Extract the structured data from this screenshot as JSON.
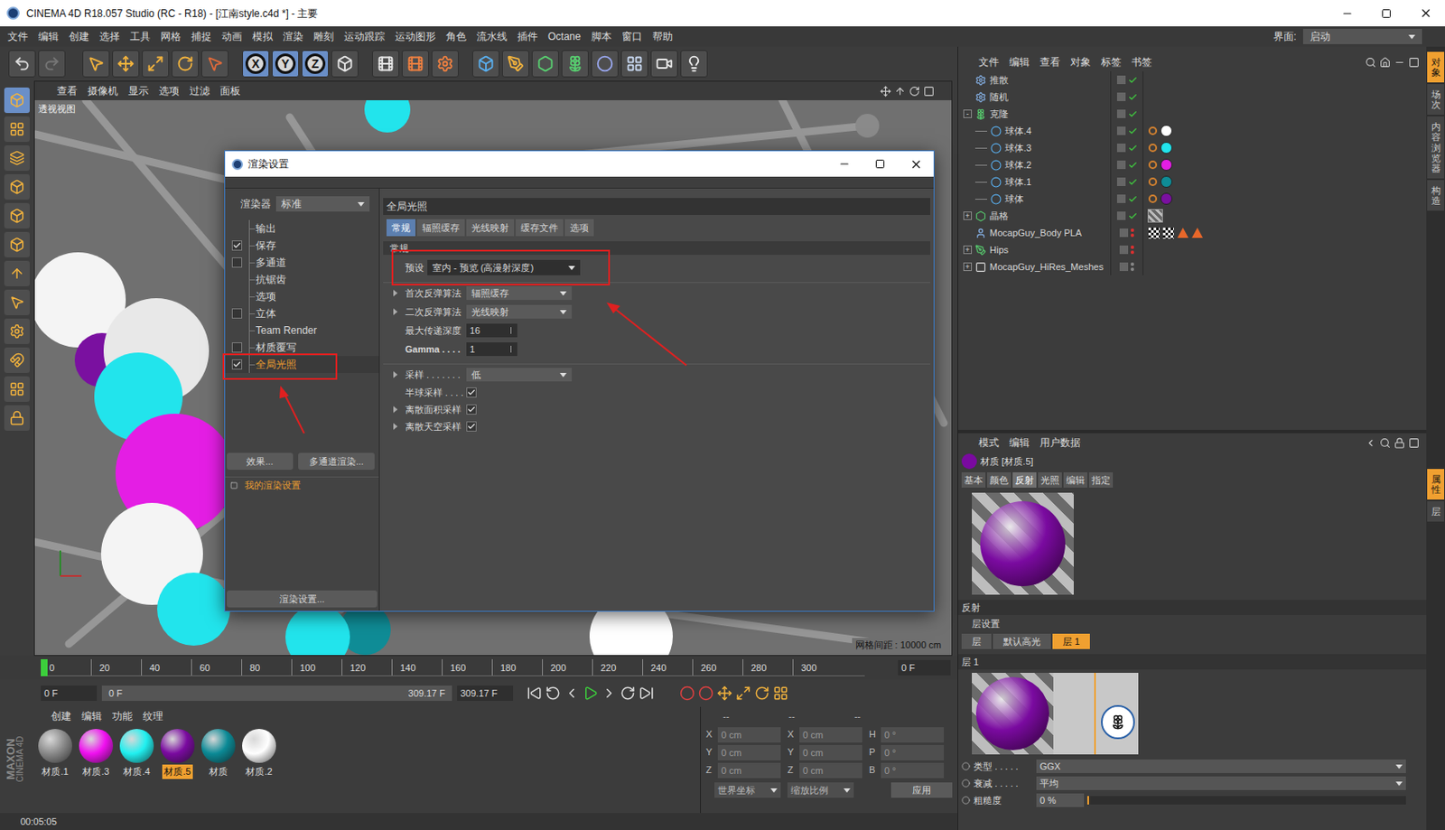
{
  "window": {
    "title": "CINEMA 4D R18.057 Studio (RC - R18) - [江南style.c4d *] - 主要"
  },
  "menu": [
    "文件",
    "编辑",
    "创建",
    "选择",
    "工具",
    "网格",
    "捕捉",
    "动画",
    "模拟",
    "渲染",
    "雕刻",
    "运动跟踪",
    "运动图形",
    "角色",
    "流水线",
    "插件",
    "Octane",
    "脚本",
    "窗口",
    "帮助"
  ],
  "layout": {
    "label": "界面:",
    "value": "启动"
  },
  "toolbar": {
    "axes": [
      {
        "label": "X",
        "on": true
      },
      {
        "label": "Y",
        "on": true
      },
      {
        "label": "Z",
        "on": true
      }
    ]
  },
  "viewport": {
    "menu": [
      "查看",
      "摄像机",
      "显示",
      "选项",
      "过滤",
      "面板"
    ],
    "label": "透视视图",
    "grid": "网格间距 : 10000 cm"
  },
  "render_settings": {
    "title": "渲染设置",
    "renderer_label": "渲染器",
    "renderer": "标准",
    "items": [
      {
        "label": "输出",
        "kind": "plain",
        "selected": false
      },
      {
        "label": "保存",
        "kind": "check",
        "checked": true,
        "selected": false
      },
      {
        "label": "多通道",
        "kind": "check",
        "checked": false,
        "selected": false
      },
      {
        "label": "抗锯齿",
        "kind": "plain",
        "selected": false
      },
      {
        "label": "选项",
        "kind": "plain",
        "selected": false
      },
      {
        "label": "立体",
        "kind": "check",
        "checked": false,
        "selected": false
      },
      {
        "label": "Team Render",
        "kind": "plain",
        "selected": false
      },
      {
        "label": "材质覆写",
        "kind": "check",
        "checked": false,
        "selected": false
      },
      {
        "label": "全局光照",
        "kind": "check",
        "checked": true,
        "selected": true
      }
    ],
    "buttons": [
      "效果...",
      "多通道渲染..."
    ],
    "preset_name": "我的渲染设置",
    "settings_button": "渲染设置...",
    "section": "全局光照",
    "tabs": [
      {
        "label": "常规",
        "selected": true
      },
      {
        "label": "辐照缓存",
        "selected": false
      },
      {
        "label": "光线映射",
        "selected": false
      },
      {
        "label": "缓存文件",
        "selected": false
      },
      {
        "label": "选项",
        "selected": false
      }
    ],
    "group": "常规",
    "field_groups": [
      [
        {
          "label": "预设",
          "kind": "preset",
          "value": "室内 - 预览 (高漫射深度)",
          "expandable": false
        }
      ],
      [
        {
          "label": "首次反弹算法",
          "kind": "dropdown",
          "value": "辐照缓存",
          "expandable": true
        },
        {
          "label": "二次反弹算法",
          "kind": "dropdown",
          "value": "光线映射",
          "expandable": true
        },
        {
          "label": "最大传递深度",
          "kind": "number",
          "value": "16",
          "expandable": false
        },
        {
          "label": "Gamma . . . .",
          "kind": "number",
          "value": "1",
          "expandable": false,
          "bold": true
        }
      ],
      [
        {
          "label": "采样 . . . . . . .",
          "kind": "dropdown",
          "value": "低",
          "expandable": true
        },
        {
          "label": "半球采样 . . . .",
          "kind": "check",
          "checked": true,
          "expandable": false
        },
        {
          "label": "离散面积采样",
          "kind": "check",
          "checked": true,
          "expandable": true
        },
        {
          "label": "离散天空采样",
          "kind": "check",
          "checked": true,
          "expandable": true
        }
      ]
    ]
  },
  "object_manager": {
    "menu": [
      "文件",
      "编辑",
      "查看",
      "对象",
      "标签",
      "书签"
    ],
    "objects": [
      {
        "name": "推散",
        "kind": "effector",
        "depth": 0,
        "toggle": "",
        "visibility": "on",
        "tags": []
      },
      {
        "name": "随机",
        "kind": "effector",
        "depth": 0,
        "toggle": "",
        "visibility": "on",
        "tags": []
      },
      {
        "name": "克隆",
        "kind": "cloner",
        "depth": 0,
        "toggle": "-",
        "visibility": "on",
        "tags": []
      },
      {
        "name": "球体.4",
        "kind": "sphere",
        "depth": 1,
        "toggle": "",
        "visibility": "on",
        "tags": [
          {
            "kind": "phong",
            "color": "#d08030"
          },
          {
            "kind": "material",
            "color": "#ffffff"
          }
        ]
      },
      {
        "name": "球体.3",
        "kind": "sphere",
        "depth": 1,
        "toggle": "",
        "visibility": "on",
        "tags": [
          {
            "kind": "phong",
            "color": "#d08030"
          },
          {
            "kind": "material",
            "color": "#22e4ec"
          }
        ]
      },
      {
        "name": "球体.2",
        "kind": "sphere",
        "depth": 1,
        "toggle": "",
        "visibility": "on",
        "tags": [
          {
            "kind": "phong",
            "color": "#d08030"
          },
          {
            "kind": "material",
            "color": "#e41ee4"
          }
        ]
      },
      {
        "name": "球体.1",
        "kind": "sphere",
        "depth": 1,
        "toggle": "",
        "visibility": "on",
        "tags": [
          {
            "kind": "phong",
            "color": "#d08030"
          },
          {
            "kind": "material",
            "color": "#0f8c96"
          }
        ]
      },
      {
        "name": "球体",
        "kind": "sphere",
        "depth": 1,
        "toggle": "",
        "visibility": "on",
        "tags": [
          {
            "kind": "phong",
            "color": "#d08030"
          },
          {
            "kind": "material",
            "color": "#7a10a0"
          }
        ]
      },
      {
        "name": "晶格",
        "kind": "lattice",
        "depth": 0,
        "toggle": "+",
        "visibility": "on",
        "tags": [
          {
            "kind": "texture",
            "color": "#9a9a9a"
          }
        ]
      },
      {
        "name": "MocapGuy_Body PLA",
        "kind": "figure",
        "depth": 0,
        "toggle": "",
        "visibility": "off",
        "tags": [
          {
            "kind": "checker",
            "color": "#ffffff"
          },
          {
            "kind": "checker",
            "color": "#ffffff"
          },
          {
            "kind": "triangle",
            "color": "#e8672a"
          },
          {
            "kind": "triangle",
            "color": "#e8672a"
          }
        ]
      },
      {
        "name": "Hips",
        "kind": "joint",
        "depth": 0,
        "toggle": "+",
        "visibility": "off",
        "tags": []
      },
      {
        "name": "MocapGuy_HiRes_Meshes",
        "kind": "null",
        "depth": 0,
        "toggle": "+",
        "visibility": "none",
        "tags": []
      }
    ]
  },
  "attributes": {
    "menu": [
      "模式",
      "编辑",
      "用户数据"
    ],
    "material": "材质 [材质.5]",
    "tabs": [
      {
        "label": "基本",
        "selected": false
      },
      {
        "label": "颜色",
        "selected": false
      },
      {
        "label": "反射",
        "selected": true
      },
      {
        "label": "光照",
        "selected": false
      },
      {
        "label": "编辑",
        "selected": false
      },
      {
        "label": "指定",
        "selected": false
      }
    ],
    "section": "反射",
    "layer_settings": "层设置",
    "layer_tabs": [
      {
        "label": "层",
        "selected": false
      },
      {
        "label": "默认高光",
        "selected": false
      },
      {
        "label": "层 1",
        "selected": true
      }
    ],
    "layer_title": "层 1",
    "fields": [
      {
        "label": "类型 . . . . .",
        "kind": "dropdown",
        "value": "GGX"
      },
      {
        "label": "衰减 . . . . .",
        "kind": "dropdown",
        "value": "平均"
      },
      {
        "label": "粗糙度",
        "kind": "slider",
        "value": "0 %",
        "level": 0
      }
    ]
  },
  "timeline": {
    "ticks": [
      "0",
      "20",
      "40",
      "60",
      "80",
      "100",
      "120",
      "140",
      "160",
      "180",
      "200",
      "220",
      "240",
      "260",
      "280",
      "300"
    ],
    "frame": "0 F",
    "start": "0 F",
    "slider_start": "0 F",
    "slider_end": "309.17 F",
    "end": "309.17 F"
  },
  "materials": {
    "menu": [
      "创建",
      "编辑",
      "功能",
      "纹理"
    ],
    "items": [
      {
        "name": "材质.1",
        "color": "#8a8a8a",
        "selected": false
      },
      {
        "name": "材质.3",
        "color": "#f010f0",
        "selected": false
      },
      {
        "name": "材质.4",
        "color": "#20f0f0",
        "selected": false
      },
      {
        "name": "材质.5",
        "color": "#7a0aa0",
        "selected": true
      },
      {
        "name": "材质",
        "color": "#0b8a96",
        "selected": false
      },
      {
        "name": "材质.2",
        "color": "#ffffff",
        "selected": false
      }
    ]
  },
  "coordinates": {
    "headers": [
      "--",
      "--",
      "--"
    ],
    "rows": [
      {
        "a": "X",
        "pos": "0 cm",
        "b": "X",
        "size": "0 cm",
        "c": "H",
        "rot": "0 °"
      },
      {
        "a": "Y",
        "pos": "0 cm",
        "b": "Y",
        "size": "0 cm",
        "c": "P",
        "rot": "0 °"
      },
      {
        "a": "Z",
        "pos": "0 cm",
        "b": "Z",
        "size": "0 cm",
        "c": "B",
        "rot": "0 °"
      }
    ],
    "mode": "世界坐标",
    "scale": "缩放比例",
    "apply": "应用"
  },
  "status": "00:05:05",
  "side_tabs": {
    "top": [
      {
        "label": "对象",
        "selected": true
      },
      {
        "label": "场次",
        "selected": false
      },
      {
        "label": "内容浏览器",
        "selected": false
      },
      {
        "label": "构造",
        "selected": false
      }
    ],
    "bottom": [
      {
        "label": "属性",
        "selected": true
      },
      {
        "label": "层",
        "selected": false
      }
    ]
  },
  "logo": [
    "MAXON",
    "CINEMA 4D"
  ]
}
